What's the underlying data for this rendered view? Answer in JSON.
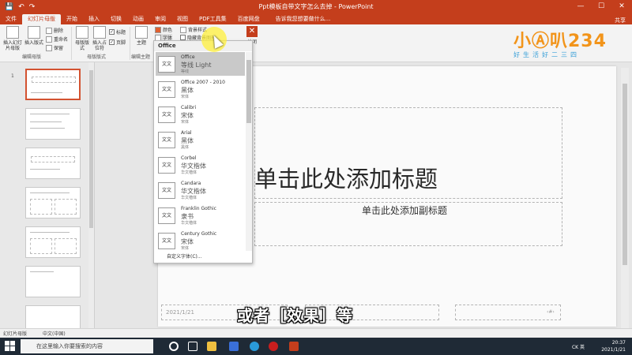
{
  "window": {
    "title": "Ppt模板自带文字怎么去掉 - PowerPoint",
    "controls": [
      "—",
      "☐",
      "✕"
    ]
  },
  "tabs": {
    "items": [
      {
        "label": "文件"
      },
      {
        "label": "幻灯片母版",
        "active": true
      },
      {
        "label": "开始"
      },
      {
        "label": "插入"
      },
      {
        "label": "切换"
      },
      {
        "label": "动画"
      },
      {
        "label": "审阅"
      },
      {
        "label": "视图"
      },
      {
        "label": "PDF工具集"
      },
      {
        "label": "百度网盘"
      }
    ],
    "tell_me": "告诉我您想要做什么...",
    "share": "共享"
  },
  "ribbon": {
    "insert_master": "插入幻灯片母版",
    "insert_layout": "插入版式",
    "delete": "删除",
    "rename": "重命名",
    "preserve": "保留",
    "group_edit_master": "编辑母版",
    "master_layout": "母版版式",
    "insert_placeholder": "插入占位符",
    "title_check": "标题",
    "footer_check": "页脚",
    "group_master_layout": "母版版式",
    "theme": "主题",
    "group_edit_theme": "编辑主题",
    "colors": "颜色",
    "background_styles": "背景样式",
    "fonts": "字体",
    "hide_bg_graphics": "隐藏背景图形",
    "close_master": "关闭母版视图",
    "close_label": "关闭"
  },
  "font_dropdown": {
    "header": "Office",
    "preview_text": "文文",
    "items": [
      {
        "name": "Office",
        "heading": "等线 Light",
        "body": "等线"
      },
      {
        "name": "Office 2007 - 2010",
        "heading": "黑体",
        "body": "宋体"
      },
      {
        "name": "Calibri",
        "heading": "宋体",
        "body": "宋体"
      },
      {
        "name": "Arial",
        "heading": "黑体",
        "body": "黑体"
      },
      {
        "name": "Corbel",
        "heading": "华文楷体",
        "body": "华文楷体"
      },
      {
        "name": "Candara",
        "heading": "华文楷体",
        "body": "华文楷体"
      },
      {
        "name": "Franklin Gothic",
        "heading": "隶书",
        "body": "华文楷体"
      },
      {
        "name": "Century Gothic",
        "heading": "宋体",
        "body": "宋体"
      }
    ],
    "custom": "自定义字体(C)..."
  },
  "thumbnails": {
    "numbers": [
      "1"
    ]
  },
  "slide": {
    "title": "单击此处添加标题",
    "subtitle": "单击此处添加副标题",
    "date": "2021/1/21",
    "number": "‹#›"
  },
  "statusbar": {
    "view": "幻灯片母版",
    "language": "中文(中国)"
  },
  "caption": "或者［效果］等",
  "logo": {
    "brand": "小Ⓐ叭234",
    "tagline": "好生活好二三四"
  },
  "taskbar": {
    "search_placeholder": "在这里输入你要搜索的内容",
    "ime": "CK 英",
    "time": "20:37",
    "date": "2021/1/21"
  },
  "colors": {
    "accent": "#c43e1c",
    "ribbon_bg": "#f3f3f3",
    "taskbar": "#1f2a36"
  }
}
